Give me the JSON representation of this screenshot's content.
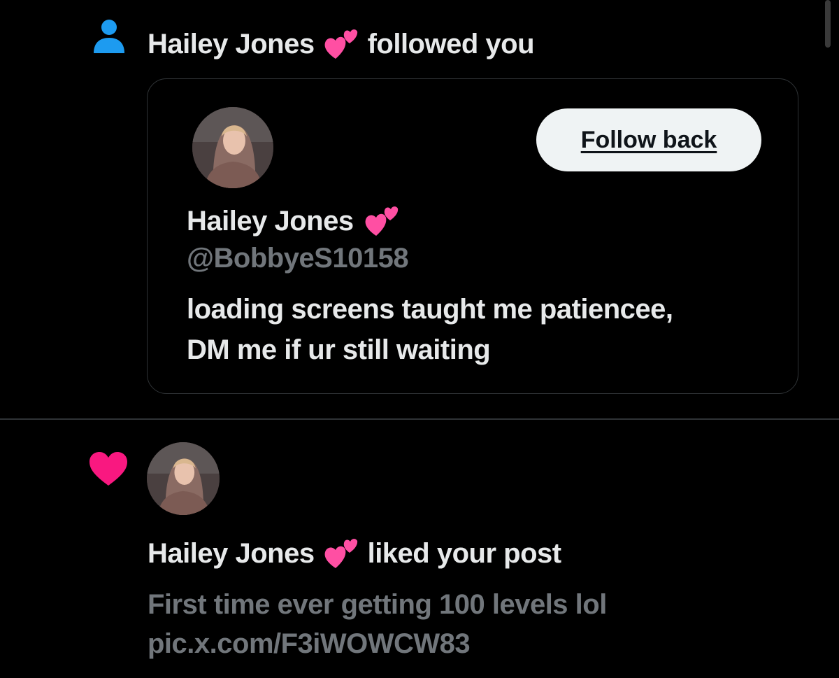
{
  "follow_notification": {
    "actor_name": "Hailey Jones",
    "action_text": "followed you",
    "card": {
      "display_name": "Hailey Jones",
      "handle": "@BobbyeS10158",
      "bio_line_1": "loading screens taught me patiencee,",
      "bio_line_2": "DM me if ur still waiting",
      "follow_back_label": "Follow back"
    }
  },
  "like_notification": {
    "actor_name": "Hailey Jones",
    "action_text": "liked your post",
    "post_line_1": "First time ever getting 100 levels lol",
    "post_line_2": "pic.x.com/F3iWOWCW83"
  },
  "colors": {
    "background": "#000000",
    "text_primary": "#e7e9ea",
    "text_secondary": "#71767b",
    "follow_icon": "#1d9bf0",
    "like_icon": "#f91880",
    "button_bg": "#eff3f4"
  },
  "icons": {
    "follow": "person-icon",
    "like": "heart-filled-icon",
    "name_emoji": "two-hearts-emoji-icon"
  }
}
